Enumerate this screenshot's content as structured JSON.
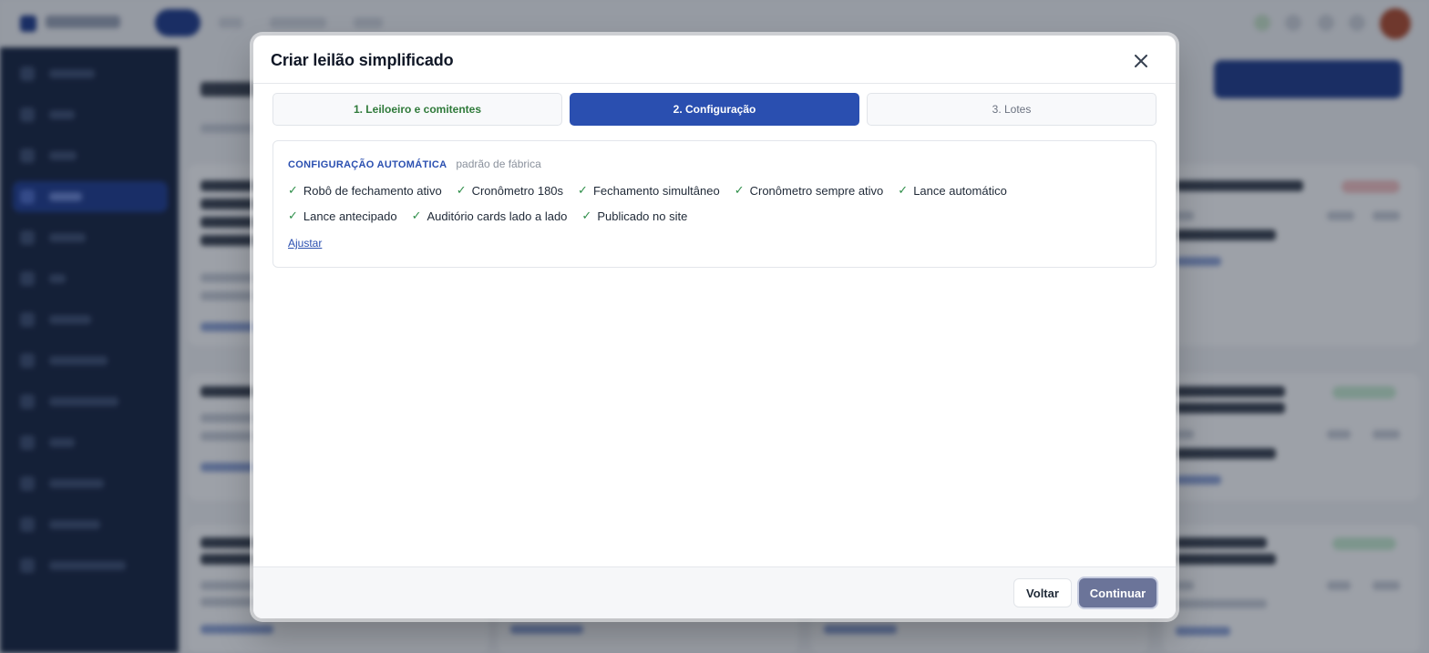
{
  "modal": {
    "title": "Criar leilão simplificado",
    "close_icon": "close-icon"
  },
  "steps": [
    {
      "label": "1. Leiloeiro e comitentes",
      "state": "done"
    },
    {
      "label": "2. Configuração",
      "state": "current"
    },
    {
      "label": "3. Lotes",
      "state": "todo"
    }
  ],
  "config": {
    "title": "CONFIGURAÇÃO AUTOMÁTICA",
    "subtitle": "padrão de fábrica",
    "check_glyph": "✓",
    "features_row1": [
      "Robô de fechamento ativo",
      "Cronômetro 180s",
      "Fechamento simultâneo",
      "Cronômetro sempre ativo",
      "Lance automático"
    ],
    "features_row2": [
      "Lance antecipado",
      "Auditório cards lado a lado",
      "Publicado no site"
    ],
    "adjust_label": "Ajustar"
  },
  "footer": {
    "back_label": "Voltar",
    "continue_label": "Continuar"
  },
  "colors": {
    "primary": "#2a4fb0",
    "done_green": "#2f7a3a",
    "check_green": "#2f8f4a",
    "sidebar": "#14213d",
    "continue_disabled": "#6b7499"
  }
}
